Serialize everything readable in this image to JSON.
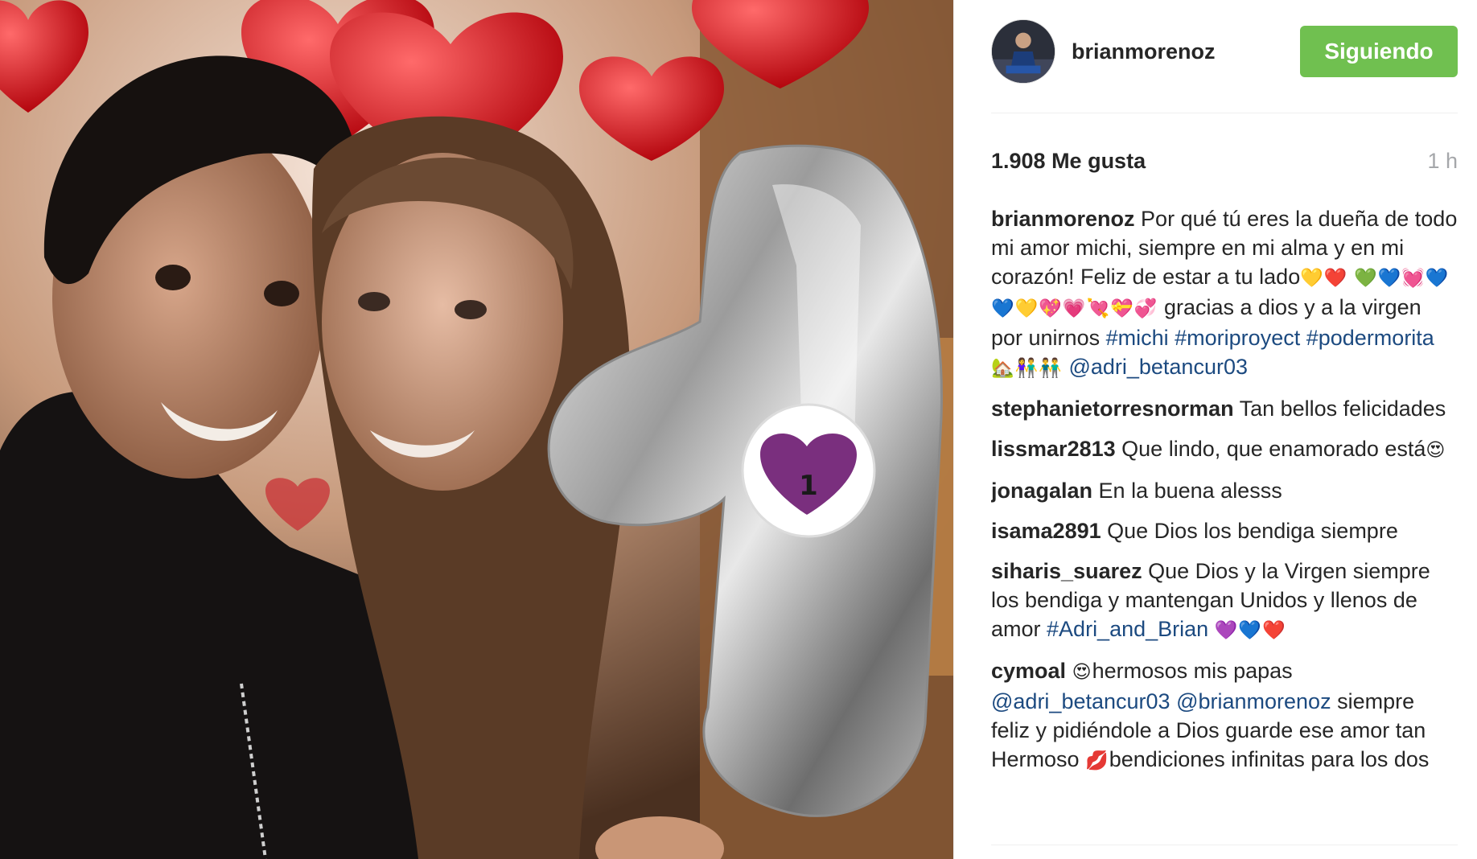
{
  "post": {
    "username": "brianmorenoz",
    "follow_label": "Siguiendo",
    "likes": "1.908 Me gusta",
    "time": "1 h",
    "caption": {
      "user": "brianmorenoz",
      "text": "Por qué tú eres la dueña de todo mi amor michi, siempre en mi alma y en mi corazón! Feliz de estar a tu lado",
      "emoji_1": "💛❤️",
      "emoji_2": "💚💙💓💙💙💛💖💗💘💝💞",
      "text_2": "gracias a dios y a la virgen por unirnos",
      "hashtag_1": "#michi",
      "hashtag_2": "#moriproyect",
      "hashtag_3": "#podermorita",
      "emoji_3": "🏡👫👬",
      "mention": "@adri_betancur03"
    }
  },
  "comments": [
    {
      "user": "stephanietorresnorman",
      "text": "Tan bellos felicidades"
    },
    {
      "user": "lissmar2813",
      "text": "Que lindo, que enamorado está",
      "emoji": "😍"
    },
    {
      "user": "jonagalan",
      "text": "En la buena alesss"
    },
    {
      "user": "isama2891",
      "text": "Que Dios los bendiga siempre"
    },
    {
      "user": "siharis_suarez",
      "text": "Que Dios y la Virgen siempre los bendiga y mantengan Unidos y llenos de amor",
      "hashtag": "#Adri_and_Brian",
      "emoji": "💜💙❤️"
    },
    {
      "user": "cymoal",
      "emoji_1": "😍",
      "text_1": "hermosos mis papas",
      "mention_1": "@adri_betancur03",
      "mention_2": "@brianmorenoz",
      "text_2": "siempre feliz y pidiéndole a Dios guarde ese amor tan Hermoso",
      "emoji_2": "💋",
      "text_3": "bendiciones infinitas para los dos"
    }
  ],
  "colors": {
    "follow_button": "#70c050",
    "hashtag": "#1c4a80",
    "text": "#262626",
    "muted": "#a5a7aa"
  },
  "photo": {
    "balloon_number": "1"
  }
}
